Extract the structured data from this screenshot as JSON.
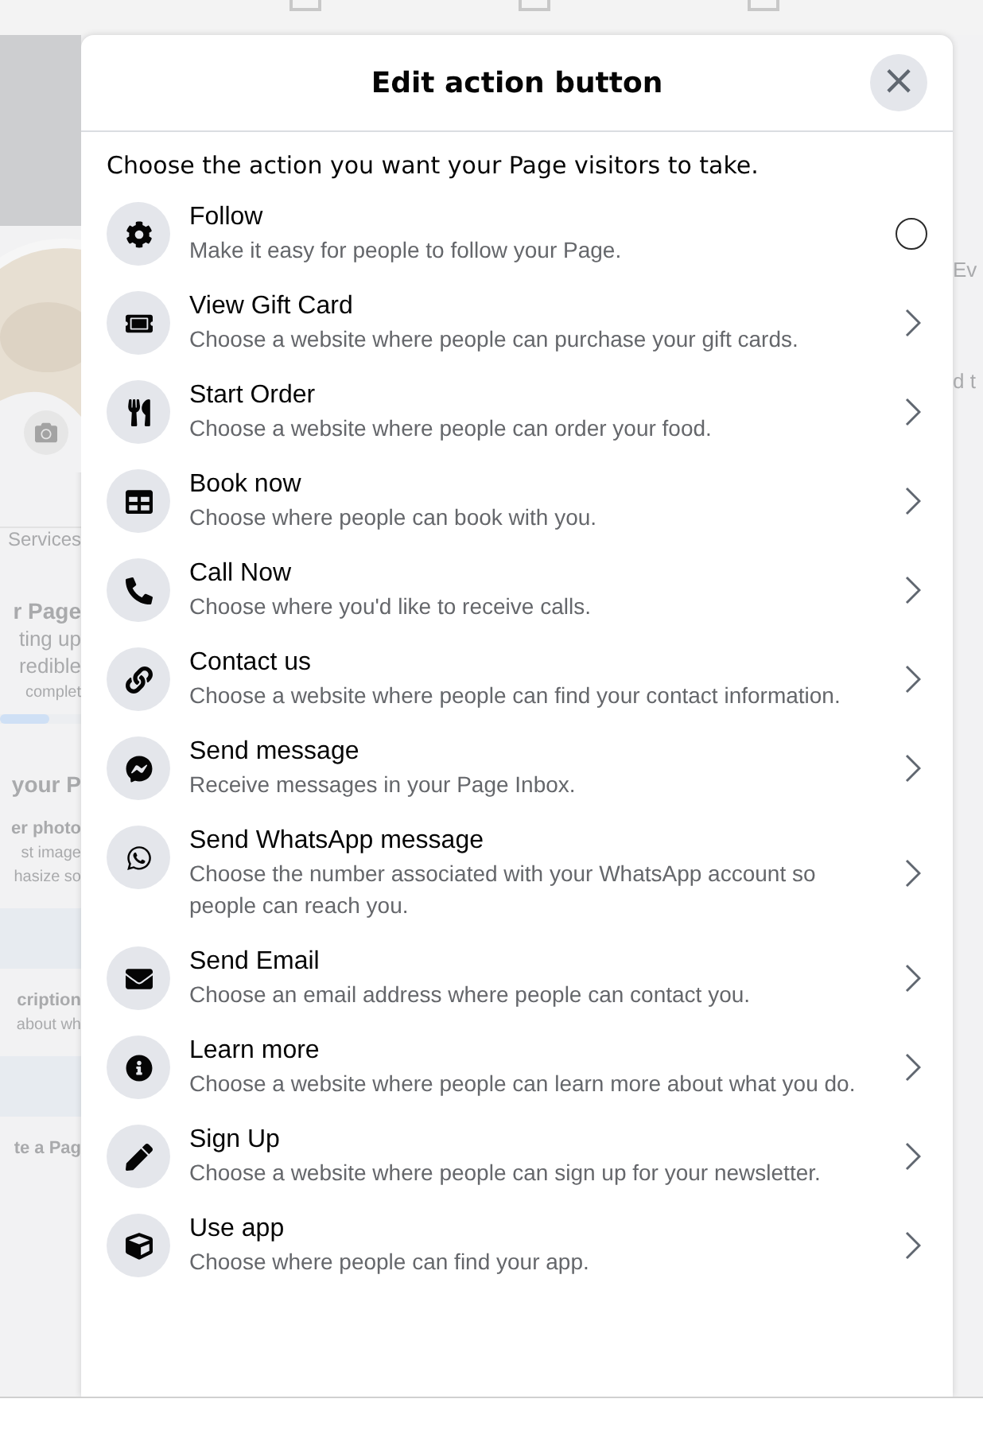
{
  "background": {
    "left_texts": [
      {
        "kind": "link",
        "text": "Services"
      },
      {
        "kind": "heading",
        "text": "r Page"
      },
      {
        "kind": "body",
        "text": "ting up"
      },
      {
        "kind": "body",
        "text": "redible"
      },
      {
        "kind": "small",
        "text": "complet"
      },
      {
        "kind": "bar",
        "level": 0.6
      },
      {
        "kind": "heading",
        "text": "your P"
      },
      {
        "kind": "subheading",
        "text": "er photo"
      },
      {
        "kind": "small",
        "text": "st image"
      },
      {
        "kind": "small",
        "text": "hasize so"
      },
      {
        "kind": "button"
      },
      {
        "kind": "subheading",
        "text": "cription"
      },
      {
        "kind": "small",
        "text": "about wh"
      },
      {
        "kind": "button"
      },
      {
        "kind": "subheading",
        "text": "te a Pag"
      }
    ],
    "right_texts": [
      "Ev",
      "d t"
    ]
  },
  "dialog": {
    "title": "Edit action button",
    "close": "×",
    "intro": "Choose the action you want your Page visitors to take.",
    "actions": [
      {
        "kind": "radio",
        "selected": false,
        "title": "Follow",
        "description": "Make it easy for people to follow your Page."
      },
      {
        "kind": "link",
        "title": "View Gift Card",
        "description": "Choose a website where people can purchase your gift cards."
      },
      {
        "kind": "link",
        "title": "Start Order",
        "description": "Choose a website where people can order your food."
      },
      {
        "kind": "link",
        "title": "Book now",
        "description": "Choose where people can book with you."
      },
      {
        "kind": "link",
        "title": "Call Now",
        "description": "Choose where you'd like to receive calls."
      },
      {
        "kind": "link",
        "title": "Contact us",
        "description": "Choose a website where people can find your contact information."
      },
      {
        "kind": "link",
        "title": "Send message",
        "description": "Receive messages in your Page Inbox."
      },
      {
        "kind": "link",
        "title": "Send WhatsApp message",
        "description": "Choose the number associated with your WhatsApp account so people can reach you."
      },
      {
        "kind": "link",
        "title": "Send Email",
        "description": "Choose an email address where people can contact you."
      },
      {
        "kind": "link",
        "title": "Learn more",
        "description": "Choose a website where people can learn more about what you do."
      },
      {
        "kind": "link",
        "title": "Sign Up",
        "description": "Choose a website where people can sign up for your newsletter."
      },
      {
        "kind": "link",
        "title": "Use app",
        "description": "Choose where people can find your app."
      }
    ]
  }
}
